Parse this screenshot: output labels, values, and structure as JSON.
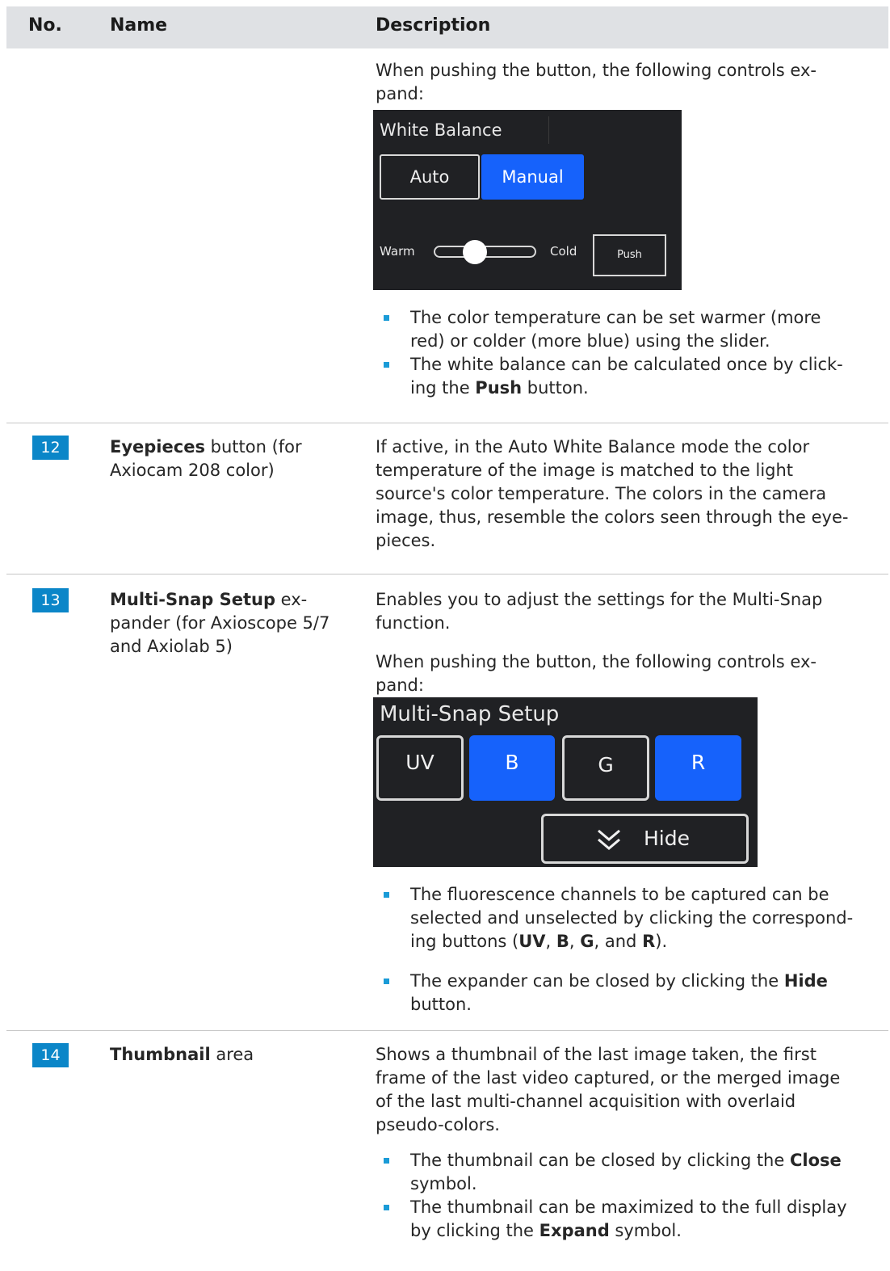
{
  "header": {
    "col_no": "No.",
    "col_name": "Name",
    "col_desc": "Description"
  },
  "row_prev": {
    "intro": "When pushing the button, the following controls ex-",
    "intro2": "pand:",
    "panel": {
      "title": "White Balance",
      "auto": "Auto",
      "manual": "Manual",
      "warm": "Warm",
      "cold": "Cold",
      "push": "Push",
      "slider_position": 0.4
    },
    "b1_l1": "The color temperature can be set warmer (more",
    "b1_l2": "red) or colder (more blue) using the slider.",
    "b2_l1": "The white balance can be calculated once by click-",
    "b2_pre": "ing the ",
    "b2_bold": "Push",
    "b2_post": " button."
  },
  "row12": {
    "no": "12",
    "name_bold": "Eyepieces",
    "name_rest": " button (for",
    "name_l2": "Axiocam 208 color)",
    "d_l1": "If active, in the Auto White Balance mode the color",
    "d_l2": "temperature of the image is matched to the light",
    "d_l3": "source's color temperature. The colors in the camera",
    "d_l4": "image, thus, resemble the colors seen through the eye-",
    "d_l5": "pieces."
  },
  "row13": {
    "no": "13",
    "name_bold": "Multi-Snap Setup",
    "name_rest": " ex-",
    "name_l2": "pander (for Axioscope 5/7",
    "name_l3": "and Axiolab 5)",
    "d_l1": "Enables you to adjust the settings for the Multi-Snap",
    "d_l2": "function.",
    "d_l3": "When pushing the button, the following controls ex-",
    "d_l4": "pand:",
    "panel": {
      "title": "Multi-Snap Setup",
      "uv": "UV",
      "b": "B",
      "g": "G",
      "r": "R",
      "hide": "Hide"
    },
    "b1_l1": "The fluorescence channels to be captured can be",
    "b1_l2": "selected and unselected by clicking the correspond-",
    "b1_pre": "ing buttons (",
    "b1_uv": "UV",
    "b1_c1": ", ",
    "b1_b": "B",
    "b1_c2": ", ",
    "b1_g": "G",
    "b1_and": ", and ",
    "b1_r": "R",
    "b1_end": ").",
    "b2_pre": "The expander can be closed by clicking the ",
    "b2_bold": "Hide",
    "b2_l2": "button."
  },
  "row14": {
    "no": "14",
    "name_bold": "Thumbnail",
    "name_rest": " area",
    "d_l1": "Shows a thumbnail of the last image taken, the first",
    "d_l2": "frame of the last video captured, or the merged image",
    "d_l3": "of the last multi-channel acquisition with overlaid",
    "d_l4": "pseudo-colors.",
    "b1_pre": "The thumbnail can be closed by clicking the ",
    "b1_bold": "Close",
    "b1_l2": "symbol.",
    "b2_l1": "The thumbnail can be maximized to the full display",
    "b2_pre": "by clicking the ",
    "b2_bold": "Expand",
    "b2_post": " symbol."
  },
  "colors": {
    "accent": "#0b86c8",
    "ui_blue": "#1662fb",
    "ui_bg": "#202124",
    "header_bg": "#dfe1e4",
    "bullet": "#1a9bd7"
  },
  "icons": {
    "hide_chevron": "double-chevron-down-icon"
  }
}
